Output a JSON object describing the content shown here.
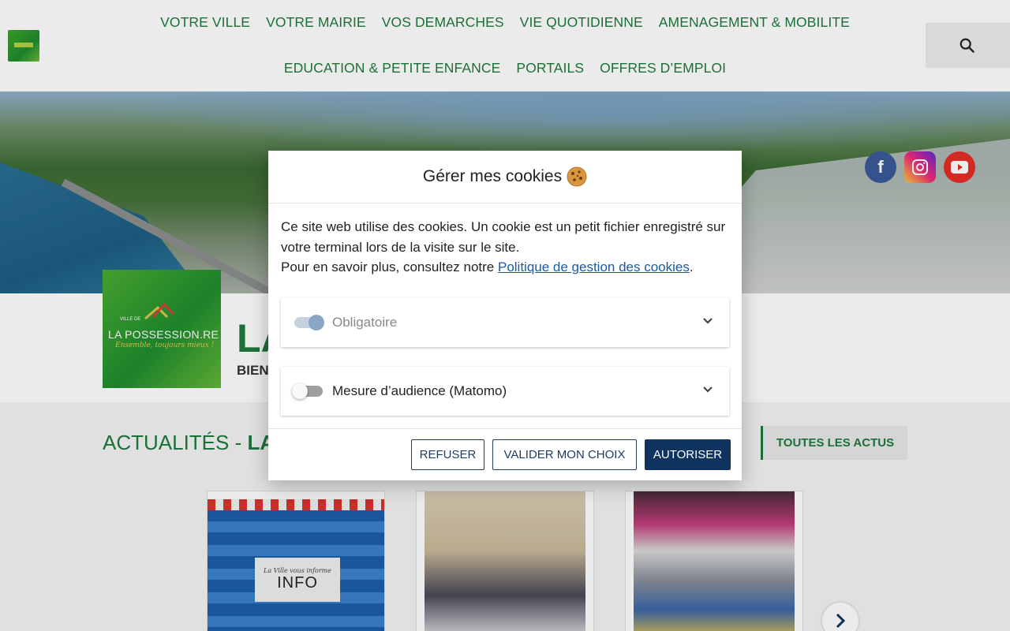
{
  "nav": {
    "row1": [
      "VOTRE VILLE",
      "VOTRE MAIRIE",
      "VOS DEMARCHES",
      "VIE QUOTIDIENNE",
      "AMENAGEMENT & MOBILITE"
    ],
    "row2": [
      "EDUCATION & PETITE ENFANCE",
      "PORTAILS",
      "OFFRES D’EMPLOI"
    ]
  },
  "logo": {
    "ville": "VILLE DE",
    "name": "LA POSSESSION.RE",
    "tagline": "Ensemble, toujours mieux !"
  },
  "hero": {
    "title_visible": "LA",
    "subtitle_visible": "BIEN"
  },
  "news": {
    "title_light": "ACTUALITÉS - ",
    "title_bold": "LA PO",
    "all_label": "TOUTES LES ACTUS",
    "card1": {
      "small": "La Ville vous informe",
      "big": "INFO"
    }
  },
  "cookie_modal": {
    "title": "Gérer mes cookies",
    "text_line1": "Ce site web utilise des cookies. Un cookie est un petit fichier enregistré sur votre terminal lors de la visite sur le site.",
    "text_line2_prefix": "Pour en savoir plus, consultez notre ",
    "policy_link": "Politique de gestion des cookies",
    "text_line2_suffix": ".",
    "options": [
      {
        "label": "Obligatoire",
        "enabled": true,
        "locked": true
      },
      {
        "label": "Mesure d’audience (Matomo)",
        "enabled": false,
        "locked": false
      }
    ],
    "buttons": {
      "refuse": "REFUSER",
      "validate": "VALIDER MON CHOIX",
      "allow": "AUTORISER"
    }
  },
  "socials": [
    "facebook-icon",
    "instagram-icon",
    "youtube-icon"
  ],
  "colors": {
    "brand_green": "#1e7a3c",
    "navy": "#0f3460",
    "link": "#1c5aa8"
  }
}
